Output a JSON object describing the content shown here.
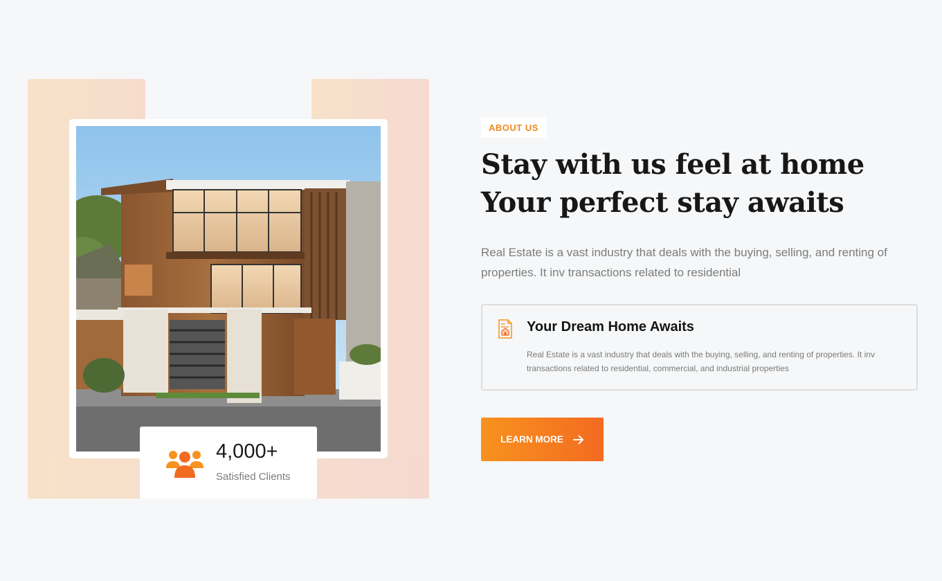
{
  "about": {
    "tag": "ABOUT US",
    "heading": "Stay with us feel at home Your perfect stay awaits",
    "intro": "Real Estate is a vast industry that deals with the buying, selling, and renting of properties. It inv transactions related to residential"
  },
  "feature": {
    "icon": "document-house-icon",
    "title": "Your Dream Home Awaits",
    "text": "Real Estate is a vast industry that deals with the buying, selling, and renting of properties. It inv transactions related to residential, commercial, and industrial properties"
  },
  "cta": {
    "label": "LEARN MORE",
    "icon": "arrow-right-icon"
  },
  "stat": {
    "icon": "users-icon",
    "value": "4,000+",
    "label": "Satisfied Clients"
  },
  "colors": {
    "accent": "#f7921e",
    "accent_end": "#f36b21",
    "background": "#f6f7f8",
    "heading": "#171717",
    "body_text": "#7c7c7c"
  }
}
